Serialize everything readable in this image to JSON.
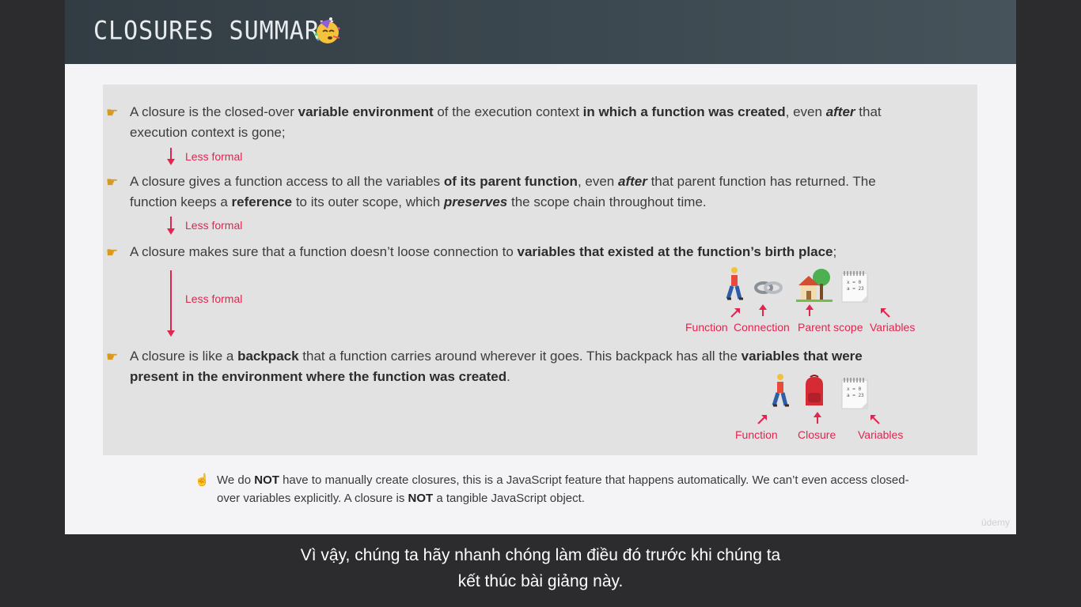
{
  "header": {
    "title": "CLOSURES SUMMARY",
    "emoji_icon": "partying-face-icon"
  },
  "bullets": [
    {
      "parts": [
        {
          "t": "A closure is the closed-over ",
          "s": "n"
        },
        {
          "t": "variable environment",
          "s": "b"
        },
        {
          "t": " of the execution context ",
          "s": "n"
        },
        {
          "t": "in which a function was created",
          "s": "b"
        },
        {
          "t": ", even ",
          "s": "n"
        },
        {
          "t": "after",
          "s": "bi"
        },
        {
          "t": " that execution context is gone;",
          "s": "n"
        }
      ]
    },
    {
      "parts": [
        {
          "t": "A closure gives a function access to all the variables ",
          "s": "n"
        },
        {
          "t": "of its parent function",
          "s": "b"
        },
        {
          "t": ", even ",
          "s": "n"
        },
        {
          "t": "after",
          "s": "bi"
        },
        {
          "t": " that parent function has returned. The function keeps a ",
          "s": "n"
        },
        {
          "t": "reference",
          "s": "b"
        },
        {
          "t": " to its outer scope, which ",
          "s": "n"
        },
        {
          "t": "preserves",
          "s": "bi"
        },
        {
          "t": " the scope chain throughout time.",
          "s": "n"
        }
      ]
    },
    {
      "parts": [
        {
          "t": "A closure makes sure that a function doesn’t loose connection to ",
          "s": "n"
        },
        {
          "t": "variables that existed at the function’s birth place",
          "s": "b"
        },
        {
          "t": ";",
          "s": "n"
        }
      ]
    },
    {
      "parts": [
        {
          "t": "A closure is like a ",
          "s": "n"
        },
        {
          "t": "backpack",
          "s": "b"
        },
        {
          "t": " that a function carries around wherever it goes. This backpack has all the ",
          "s": "n"
        },
        {
          "t": "variables that were present in the environment where the function was created",
          "s": "b"
        },
        {
          "t": ".",
          "s": "n"
        }
      ]
    }
  ],
  "less_formal_label": "Less formal",
  "diagram1": {
    "labels": [
      "Function",
      "Connection",
      "Parent scope",
      "Variables"
    ],
    "icons": [
      "person-walking-icon",
      "link-icon",
      "house-with-garden-icon",
      "spiral-notepad-icon"
    ]
  },
  "diagram2": {
    "labels": [
      "Function",
      "Closure",
      "Variables"
    ],
    "icons": [
      "person-walking-icon",
      "backpack-icon",
      "spiral-notepad-icon"
    ]
  },
  "note": {
    "icon": "pointing-up-hand-icon",
    "parts": [
      {
        "t": "We do ",
        "s": "n"
      },
      {
        "t": "NOT",
        "s": "b"
      },
      {
        "t": " have to manually create closures, this is a JavaScript feature that happens automatically. We can’t even access closed-over variables explicitly. A closure is ",
        "s": "n"
      },
      {
        "t": "NOT",
        "s": "b"
      },
      {
        "t": " a tangible JavaScript object.",
        "s": "n"
      }
    ]
  },
  "notepad_text": [
    "x = 0",
    "a = 23"
  ],
  "watermark": "ûdemy",
  "subtitle": {
    "line1": "Vì vậy, chúng ta hãy nhanh chóng làm điều đó trước khi chúng ta",
    "line2": "kết thúc bài giảng này."
  },
  "colors": {
    "accent": "#e2254f",
    "header_bg": "#3b474e",
    "panel_bg": "#e2e2e2",
    "slide_bg": "#f4f3f5",
    "page_bg": "#2c2c2e"
  }
}
